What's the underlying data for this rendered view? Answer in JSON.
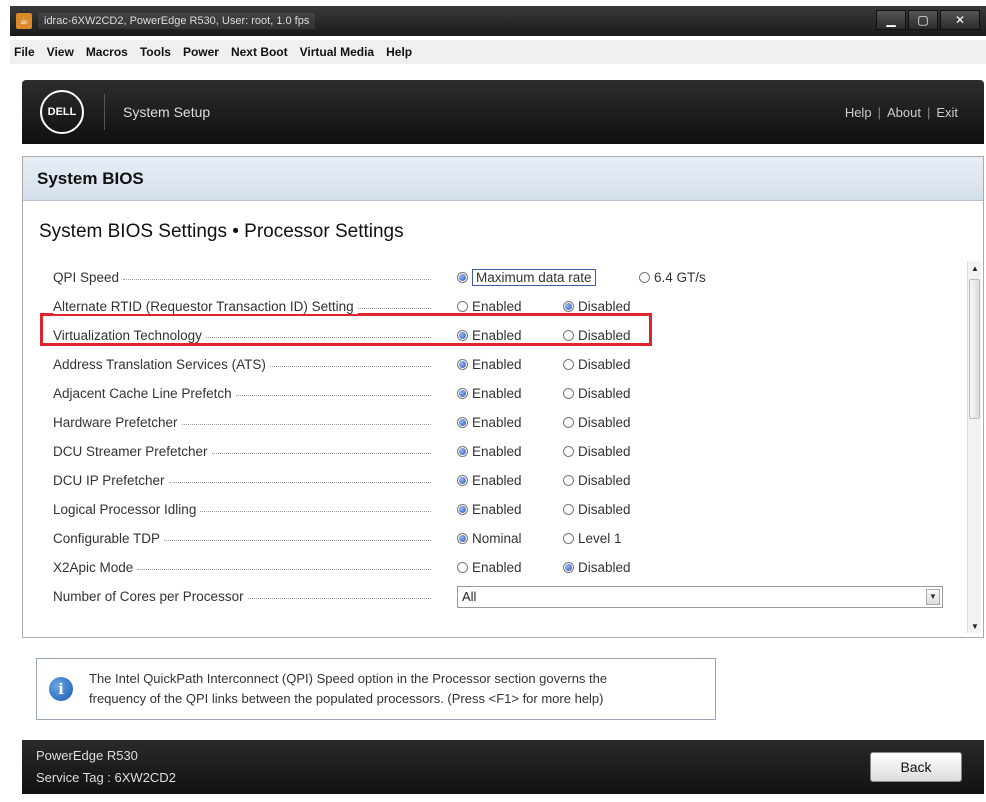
{
  "window": {
    "title": "idrac-6XW2CD2, PowerEdge R530, User: root, 1.0 fps",
    "minimize": "▁",
    "maximize": "▢",
    "close": "✕"
  },
  "menu": [
    "File",
    "View",
    "Macros",
    "Tools",
    "Power",
    "Next Boot",
    "Virtual Media",
    "Help"
  ],
  "header": {
    "logo": "DELL",
    "title": "System Setup",
    "links": [
      "Help",
      "About",
      "Exit"
    ],
    "separator": "|"
  },
  "section_title": "System BIOS",
  "page_title": "System BIOS Settings • Processor Settings",
  "settings": [
    {
      "label": "QPI Speed",
      "options": [
        "Maximum data rate",
        "6.4 GT/s"
      ],
      "selected": 0
    },
    {
      "label": "Alternate RTID (Requestor Transaction ID) Setting",
      "options": [
        "Enabled",
        "Disabled"
      ],
      "selected": 1
    },
    {
      "label": "Virtualization Technology",
      "options": [
        "Enabled",
        "Disabled"
      ],
      "selected": 0
    },
    {
      "label": "Address Translation Services (ATS)",
      "options": [
        "Enabled",
        "Disabled"
      ],
      "selected": 0
    },
    {
      "label": "Adjacent Cache Line Prefetch",
      "options": [
        "Enabled",
        "Disabled"
      ],
      "selected": 0
    },
    {
      "label": "Hardware Prefetcher",
      "options": [
        "Enabled",
        "Disabled"
      ],
      "selected": 0
    },
    {
      "label": "DCU Streamer Prefetcher",
      "options": [
        "Enabled",
        "Disabled"
      ],
      "selected": 0
    },
    {
      "label": "DCU IP Prefetcher",
      "options": [
        "Enabled",
        "Disabled"
      ],
      "selected": 0
    },
    {
      "label": "Logical Processor Idling",
      "options": [
        "Enabled",
        "Disabled"
      ],
      "selected": 0
    },
    {
      "label": "Configurable TDP",
      "options": [
        "Nominal",
        "Level 1"
      ],
      "selected": 0
    },
    {
      "label": "X2Apic Mode",
      "options": [
        "Enabled",
        "Disabled"
      ],
      "selected": 1
    },
    {
      "label": "Number of Cores per Processor",
      "select_value": "All"
    }
  ],
  "help": {
    "line1": "The Intel QuickPath Interconnect (QPI) Speed option in the Processor section governs the",
    "line2": "frequency of the QPI links between the populated processors. (Press <F1> for more help)"
  },
  "footer": {
    "model": "PowerEdge R530",
    "service_tag": "Service Tag : 6XW2CD2",
    "back_label": "Back"
  },
  "colors": {
    "highlight": "#e0242c",
    "radio_selected": "#2b56b8"
  }
}
